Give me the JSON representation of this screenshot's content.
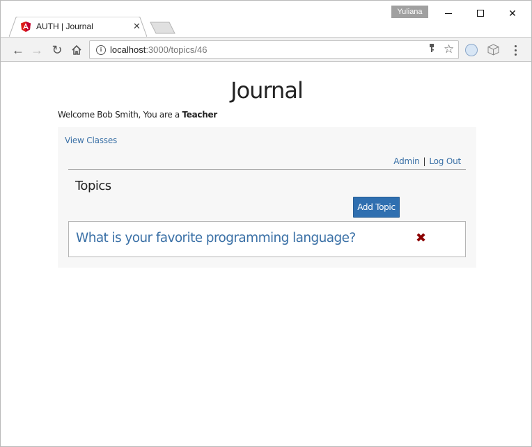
{
  "browser": {
    "profile_name": "Yuliana",
    "tab": {
      "title": "AUTH | Journal",
      "favicon": "angular-icon"
    },
    "address": {
      "host": "localhost",
      "path": ":3000/topics/46"
    },
    "accent": "#3a70a6"
  },
  "page": {
    "title": "Journal",
    "welcome": {
      "prefix": "Welcome Bob Smith, You are a ",
      "role": "Teacher"
    },
    "nav": {
      "view_classes": "View Classes",
      "admin": "Admin",
      "separator": "|",
      "logout": "Log Out"
    },
    "section_title": "Topics",
    "add_button": "Add Topic",
    "topics": [
      {
        "title": "What is your favorite programming language?",
        "delete_icon": "✖"
      }
    ]
  }
}
